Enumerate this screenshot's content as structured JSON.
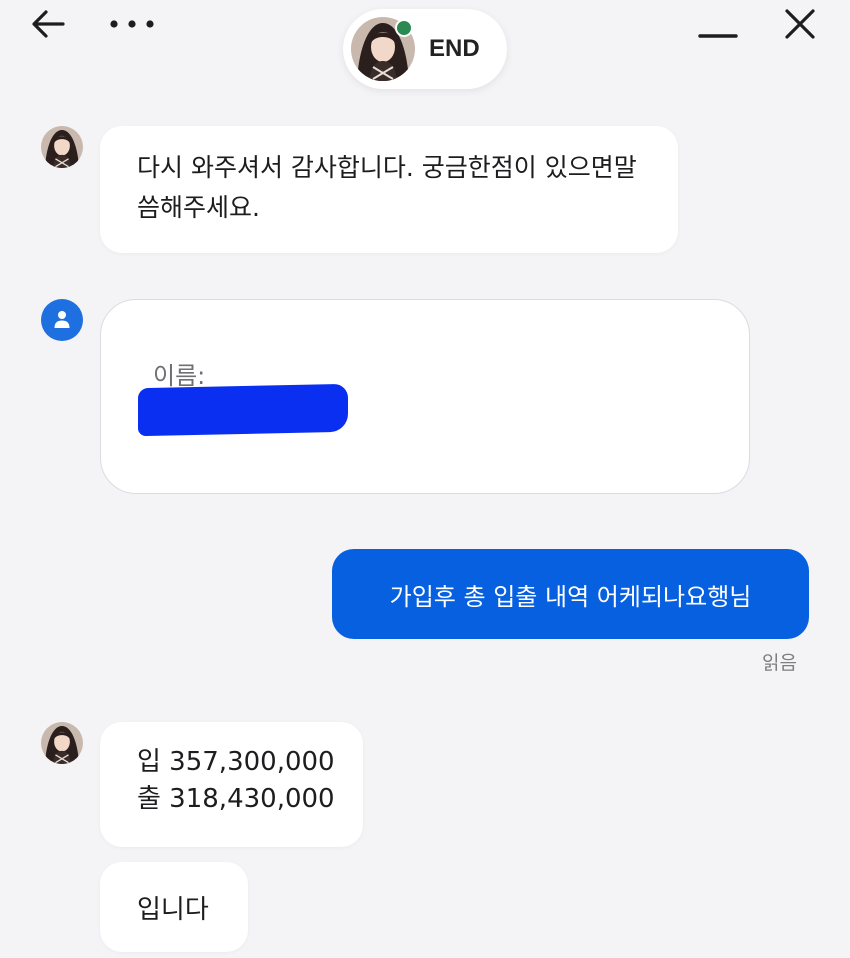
{
  "header": {
    "back_icon": "arrow-left-icon",
    "more_icon": "more-horizontal-icon",
    "minimize_icon": "minimize-icon",
    "close_icon": "close-icon",
    "agent_status_label": "END",
    "online_color": "#2a8a52"
  },
  "messages": {
    "welcome": "다시 와주셔서 감사합니다. 궁금한점이 있으면말씀해주세요.",
    "form": {
      "name_label": "이름:"
    },
    "outgoing": {
      "text": "가입후 총 입출 내역 어케되나요행님",
      "read_status": "읽음"
    },
    "reply_amounts": {
      "line1": "입 357,300,000",
      "line2": "출 318,430,000"
    },
    "reply_end": "입니다"
  },
  "colors": {
    "outgoing_bubble": "#0660e0",
    "user_avatar": "#1e6fe0",
    "redaction": "#0a2ff0",
    "background": "#f4f4f6"
  }
}
